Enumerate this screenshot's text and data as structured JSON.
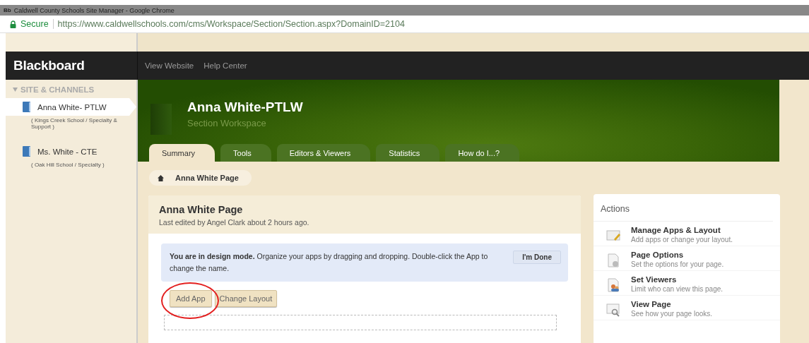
{
  "browser": {
    "favicon": "Bb",
    "title": "Caldwell County Schools Site Manager - Google Chrome",
    "secure": "Secure",
    "url": "https://www.caldwellschools.com/cms/Workspace/Section/Section.aspx?DomainID=2104"
  },
  "header": {
    "logo": "Blackboard",
    "links": [
      "View Website",
      "Help Center"
    ]
  },
  "sidebar": {
    "heading": "SITE & CHANNELS",
    "expanded": true,
    "items": [
      {
        "name": "Anna White- PTLW",
        "school": "( Kings Creek School / Specialty & Support )",
        "selected": true
      },
      {
        "name": "Ms. White - CTE",
        "school": "( Oak Hill School / Specialty )",
        "selected": false
      }
    ]
  },
  "workspace": {
    "title": "Anna White-PTLW",
    "subtitle": "Section Workspace",
    "tabs": [
      {
        "label": "Summary",
        "selected": true
      },
      {
        "label": "Tools",
        "selected": false
      },
      {
        "label": "Editors & Viewers",
        "selected": false
      },
      {
        "label": "Statistics",
        "selected": false
      },
      {
        "label": "How do I...?",
        "selected": false
      }
    ],
    "breadcrumb": "Anna White Page"
  },
  "page": {
    "title": "Anna White Page",
    "edited": "Last edited by Angel Clark about 2 hours ago.",
    "notice": "**You are in design mode.** Organize your apps by dragging and dropping. Double-click the App to change the name.",
    "done_button": "I'm Done",
    "buttons": [
      {
        "label": "Add App",
        "highlighted": true
      },
      {
        "label": "Change Layout",
        "highlighted": false
      }
    ]
  },
  "actions": {
    "title": "Actions",
    "items": [
      {
        "kind": "edit",
        "title": "Manage Apps & Layout",
        "description": "Add apps or change your layout."
      },
      {
        "kind": "options",
        "title": "Page Options",
        "description": "Set the options for your page."
      },
      {
        "kind": "viewers",
        "title": "Set Viewers",
        "description": "Limit who can view this page."
      },
      {
        "kind": "view",
        "title": "View Page",
        "description": "See how your page looks."
      }
    ]
  }
}
